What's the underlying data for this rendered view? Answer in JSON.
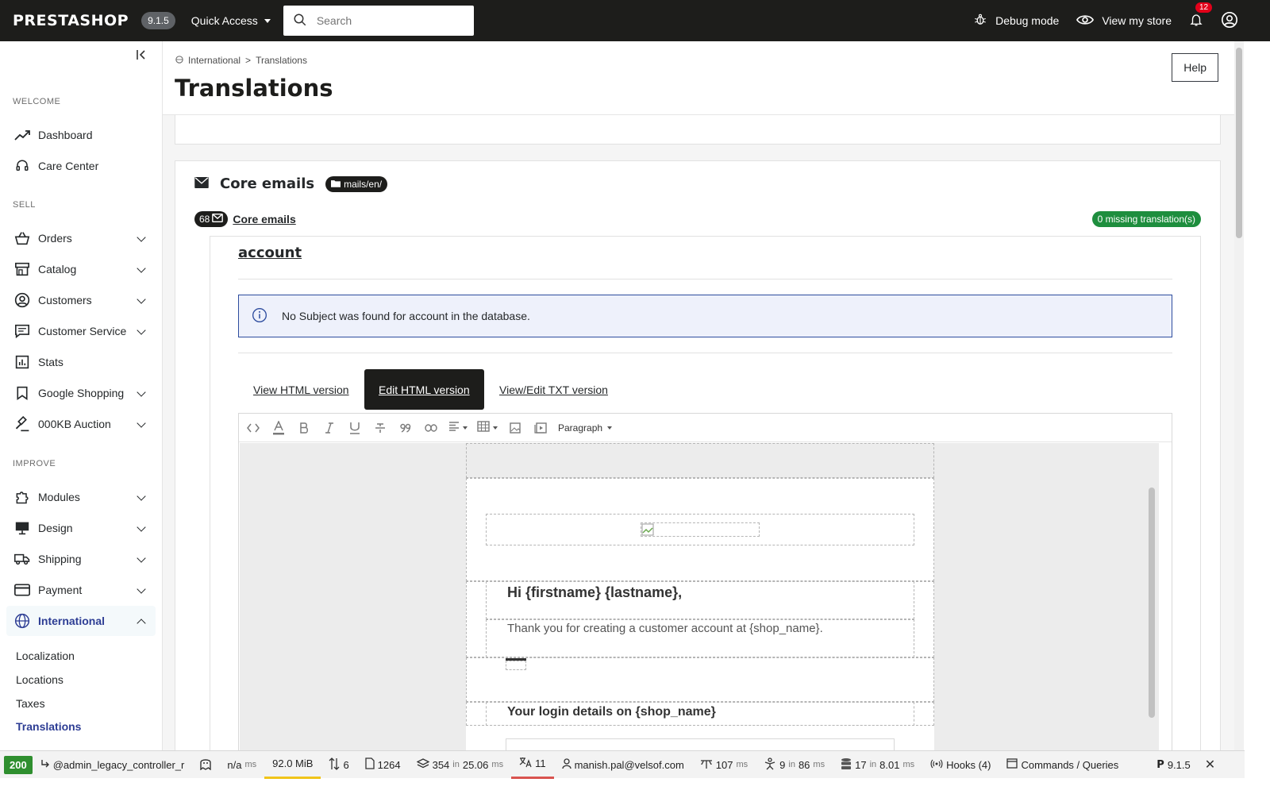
{
  "topbar": {
    "logo": "PRESTASHOP",
    "version": "9.1.5",
    "quick_access": "Quick Access",
    "search_placeholder": "Search",
    "debug_mode": "Debug mode",
    "view_store": "View my store",
    "notifications_count": "12"
  },
  "sidebar": {
    "sections": {
      "welcome": "WELCOME",
      "sell": "SELL",
      "improve": "IMPROVE"
    },
    "items": [
      {
        "label": "Dashboard",
        "icon": "trending-icon"
      },
      {
        "label": "Care Center",
        "icon": "headset-icon"
      },
      {
        "label": "Orders",
        "icon": "basket-icon"
      },
      {
        "label": "Catalog",
        "icon": "store-icon"
      },
      {
        "label": "Customers",
        "icon": "user-circle-icon"
      },
      {
        "label": "Customer Service",
        "icon": "chat-icon"
      },
      {
        "label": "Stats",
        "icon": "bar-chart-icon"
      },
      {
        "label": "Google Shopping",
        "icon": "bookmark-icon"
      },
      {
        "label": "000KB Auction",
        "icon": "gavel-icon"
      },
      {
        "label": "Modules",
        "icon": "puzzle-icon"
      },
      {
        "label": "Design",
        "icon": "monitor-icon"
      },
      {
        "label": "Shipping",
        "icon": "truck-icon"
      },
      {
        "label": "Payment",
        "icon": "card-icon"
      },
      {
        "label": "International",
        "icon": "globe-icon"
      }
    ],
    "sub_items": [
      "Localization",
      "Locations",
      "Taxes",
      "Translations"
    ]
  },
  "header": {
    "breadcrumb_parent": "International",
    "breadcrumb_sep": ">",
    "breadcrumb_current": "Translations",
    "title": "Translations",
    "help": "Help"
  },
  "card": {
    "title": "Core emails",
    "folder": "mails/en/",
    "count": "68",
    "count_label": "Core emails",
    "missing": "0 missing translation(s)",
    "account_title": "account",
    "alert": "No Subject was found for account in the database.",
    "tabs": [
      "View HTML version",
      "Edit HTML version",
      "View/Edit TXT version"
    ],
    "paragraph": "Paragraph"
  },
  "email": {
    "greeting": "Hi {firstname} {lastname},",
    "thanks": "Thank you for creating a customer account at {shop_name}.",
    "login_title": "Your login details on {shop_name}"
  },
  "debugbar": {
    "status": "200",
    "route": "@admin_legacy_controller_r",
    "time": "n/a",
    "time_unit": "ms",
    "memory": "92.0 MiB",
    "requests": "6",
    "files": "1264",
    "templates": "354",
    "templates_in": "in",
    "templates_time": "25.06",
    "templates_unit": "ms",
    "translations": "11",
    "user": "manish.pal@velsof.com",
    "events_time": "107",
    "events_unit": "ms",
    "listeners": "9",
    "listeners_in": "in",
    "listeners_time": "86",
    "listeners_unit": "ms",
    "queries": "17",
    "queries_in": "in",
    "queries_time": "8.01",
    "queries_unit": "ms",
    "hooks": "Hooks (4)",
    "commands": "Commands / Queries",
    "ps_version": "9.1.5"
  },
  "colors": {
    "topbar_bg": "#1d1d1b",
    "active_nav": "#2d3d94",
    "missing_badge": "#1e8e3e",
    "alert_border": "#2d4c9e",
    "notification_badge": "#e2001a"
  }
}
